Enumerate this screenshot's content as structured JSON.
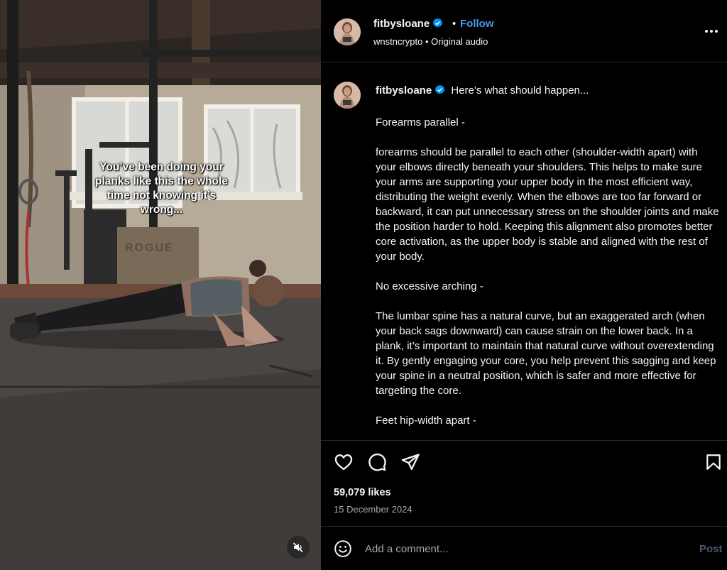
{
  "video": {
    "overlay_text": "You’ve been doing your planks like this the whole time not knowing it’s wrong...",
    "mute_icon": "speaker-muted-icon"
  },
  "header": {
    "username": "fitbysloane",
    "verified": true,
    "follow_label": "Follow",
    "separator": "•",
    "audio": "wnstncrypto • Original audio",
    "more_icon": "more-options-icon"
  },
  "caption": {
    "username": "fitbysloane",
    "intro": "Here’s what should happen...",
    "paragraphs": [
      "Forearms parallel -",
      "forearms should be parallel to each other (shoulder-width apart) with your elbows directly beneath your shoulders. This helps to make sure your arms are supporting your upper body in the most efficient way, distributing the weight evenly. When the elbows are too far forward or backward, it can put unnecessary stress on the shoulder joints and make the position harder to hold. Keeping this alignment also promotes better core activation, as the upper body is stable and aligned with the rest of your body.",
      "No excessive arching -",
      "The lumbar spine has a natural curve, but an exaggerated arch (when your back sags downward) can cause strain on the lower back. In a plank, it’s important to maintain that natural curve without overextending it. By gently engaging your core, you help prevent this sagging and keep your spine in a neutral position, which is safer and more effective for targeting the core.",
      "Feet hip-width apart -"
    ]
  },
  "actions": {
    "icons": [
      "heart-icon",
      "comment-icon",
      "share-icon",
      "bookmark-icon"
    ],
    "likes": "59,079 likes",
    "date": "15 December 2024"
  },
  "comment": {
    "placeholder": "Add a comment...",
    "post_label": "Post",
    "emoji_icon": "emoji-icon"
  },
  "colors": {
    "background": "#000000",
    "text": "#f5f5f5",
    "secondary_text": "#a8a8a8",
    "accent": "#4a97f5",
    "verified_badge": "#0095f6",
    "post_disabled": "#4d5a73"
  }
}
